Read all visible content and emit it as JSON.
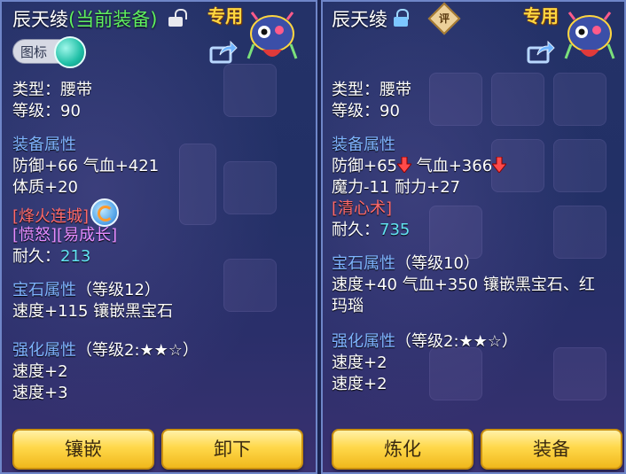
{
  "left": {
    "title": "辰天绫",
    "equipped_label": "(当前装备)",
    "special_tag": "专用",
    "icon_toggle_label": "图标",
    "type": "类型：腰带",
    "level": "等级：90",
    "attr_header": "装备属性",
    "attr_lines": [
      "防御+66 气血+421",
      "体质+20"
    ],
    "effect_red": "[烽火连城]",
    "effects_purple": "[愤怒][易成长]",
    "durability_label": "耐久：",
    "durability_value": "213",
    "gem_header": "宝石属性",
    "gem_level": "（等级12）",
    "gem_lines": [
      "速度+115 镶嵌黑宝石"
    ],
    "enhance_header": "强化属性",
    "enhance_level": "（等级2:★★☆）",
    "enhance_lines": [
      "速度+2",
      "速度+3"
    ],
    "button1": "镶嵌",
    "button2": "卸下"
  },
  "right": {
    "title": "辰天绫",
    "review_label": "评",
    "special_tag": "专用",
    "type": "类型：腰带",
    "level": "等级：90",
    "attr_header": "装备属性",
    "attr_line1_a": "防御+65",
    "attr_line1_b": " 气血+366",
    "attr_line2": "魔力-11 耐力+27",
    "effect_red": "[清心术]",
    "durability_label": "耐久：",
    "durability_value": "735",
    "gem_header": "宝石属性",
    "gem_level": "（等级10）",
    "gem_lines": [
      "速度+40 气血+350 镶嵌黑宝石、红",
      "玛瑙"
    ],
    "enhance_header": "强化属性",
    "enhance_level": "（等级2:★★☆）",
    "enhance_lines": [
      "速度+2",
      "速度+2"
    ],
    "button1": "炼化",
    "button2": "装备"
  },
  "colors": {
    "equipped_green": "#5ff05f",
    "section_blue": "#7fb4ff",
    "effect_red": "#ff6a6a",
    "effect_purple": "#e48cff",
    "durability_cyan": "#62e4f2",
    "special_gold": "#ffd640",
    "button_gold": "#ffd84a"
  },
  "icons": [
    "unlocked-lock-icon",
    "locked-lock-icon",
    "mascot-icon",
    "share-icon",
    "refresh-icon",
    "down-arrow-icon",
    "review-icon"
  ]
}
